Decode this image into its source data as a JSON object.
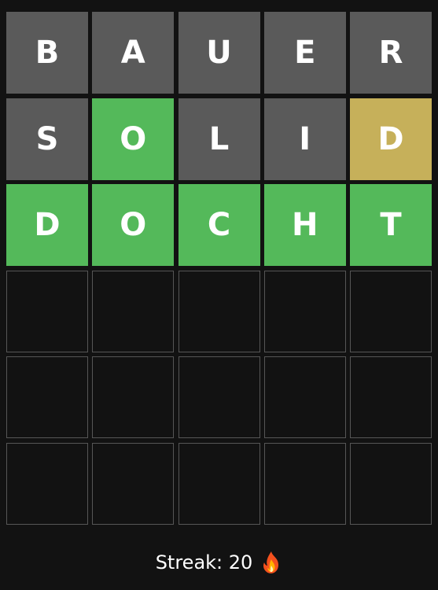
{
  "board": {
    "rows": [
      [
        {
          "letter": "B",
          "state": "absent"
        },
        {
          "letter": "A",
          "state": "absent"
        },
        {
          "letter": "U",
          "state": "absent"
        },
        {
          "letter": "E",
          "state": "absent"
        },
        {
          "letter": "R",
          "state": "absent"
        }
      ],
      [
        {
          "letter": "S",
          "state": "absent"
        },
        {
          "letter": "O",
          "state": "correct"
        },
        {
          "letter": "L",
          "state": "absent"
        },
        {
          "letter": "I",
          "state": "absent"
        },
        {
          "letter": "D",
          "state": "present"
        }
      ],
      [
        {
          "letter": "D",
          "state": "correct"
        },
        {
          "letter": "O",
          "state": "correct"
        },
        {
          "letter": "C",
          "state": "correct"
        },
        {
          "letter": "H",
          "state": "correct"
        },
        {
          "letter": "T",
          "state": "correct"
        }
      ],
      [
        {
          "letter": "",
          "state": "empty"
        },
        {
          "letter": "",
          "state": "empty"
        },
        {
          "letter": "",
          "state": "empty"
        },
        {
          "letter": "",
          "state": "empty"
        },
        {
          "letter": "",
          "state": "empty"
        }
      ],
      [
        {
          "letter": "",
          "state": "empty"
        },
        {
          "letter": "",
          "state": "empty"
        },
        {
          "letter": "",
          "state": "empty"
        },
        {
          "letter": "",
          "state": "empty"
        },
        {
          "letter": "",
          "state": "empty"
        }
      ],
      [
        {
          "letter": "",
          "state": "empty"
        },
        {
          "letter": "",
          "state": "empty"
        },
        {
          "letter": "",
          "state": "empty"
        },
        {
          "letter": "",
          "state": "empty"
        },
        {
          "letter": "",
          "state": "empty"
        }
      ]
    ]
  },
  "streak": {
    "label": "Streak: 20",
    "icon": "fire-icon"
  },
  "colors": {
    "absent": "#5a5a5a",
    "correct": "#54b95a",
    "present": "#c6b05a",
    "background": "#121212"
  }
}
